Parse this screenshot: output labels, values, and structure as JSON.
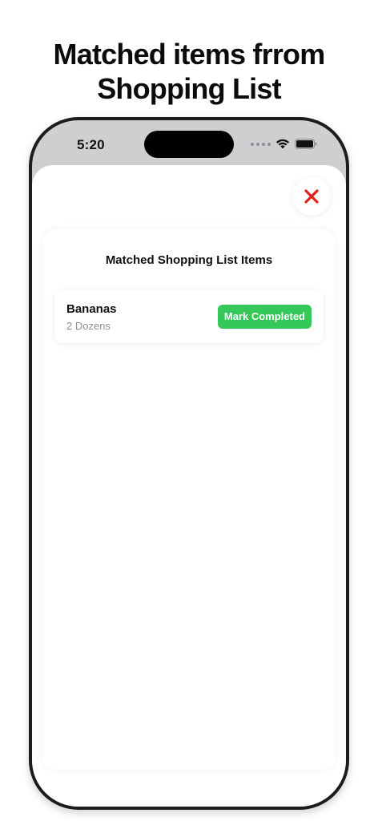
{
  "headline": {
    "line1": "Matched items frrom",
    "line2": "Shopping List"
  },
  "status_bar": {
    "time": "5:20"
  },
  "icons": {
    "close": "close-x-icon",
    "wifi": "wifi-icon",
    "battery": "battery-icon",
    "signal": "signal-dots-icon"
  },
  "colors": {
    "close_accent": "#e0211b",
    "button_green": "#34c759"
  },
  "card": {
    "title": "Matched Shopping List Items",
    "items": [
      {
        "name": "Bananas",
        "quantity": "2 Dozens",
        "action_label": "Mark Completed"
      }
    ]
  }
}
